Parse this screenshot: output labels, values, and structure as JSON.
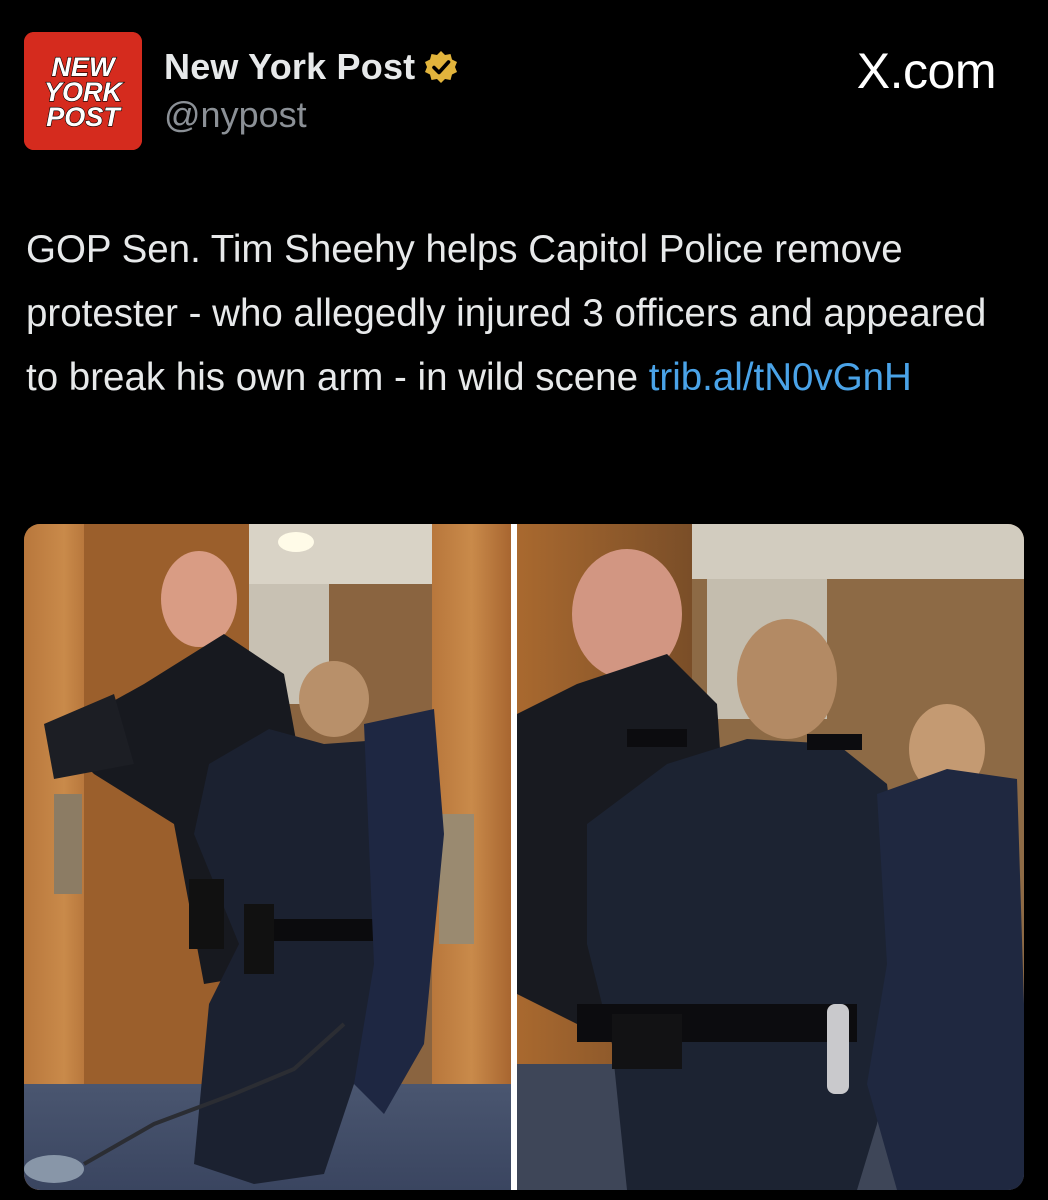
{
  "author": {
    "name": "New York Post",
    "handle": "@nypost",
    "logo_text": [
      "NEW",
      "YORK",
      "POST"
    ],
    "verified_icon": "verified-badge-gold",
    "brand_color": "#d52b1e"
  },
  "source_label": "X.com",
  "tweet": {
    "text": "GOP Sen. Tim Sheehy helps Capitol Police remove protester - who allegedly injured 3 officers and appeared to break his own arm - in wild scene ",
    "link": "trib.al/tN0vGnH",
    "link_color": "#4aa3e8"
  },
  "media": {
    "photos": [
      {
        "description_icon": "photo-left"
      },
      {
        "description_icon": "photo-right"
      }
    ]
  }
}
